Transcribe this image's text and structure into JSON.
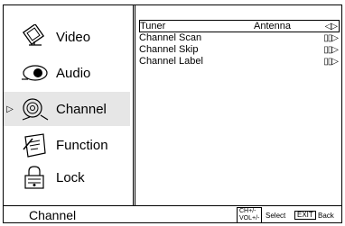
{
  "sidebar": {
    "items": [
      {
        "label": "Video",
        "icon": "monitor-icon"
      },
      {
        "label": "Audio",
        "icon": "speaker-icon"
      },
      {
        "label": "Channel",
        "icon": "satellite-dish-icon",
        "selected": true
      },
      {
        "label": "Function",
        "icon": "note-icon"
      },
      {
        "label": "Lock",
        "icon": "lock-icon"
      }
    ],
    "selected_marker": "▷"
  },
  "content": {
    "rows": [
      {
        "label": "Tuner",
        "value": "Antenna",
        "control": "◁▷"
      },
      {
        "label": "Channel Scan",
        "value": "",
        "control": "▯▯▷"
      },
      {
        "label": "Channel Skip",
        "value": "",
        "control": "▯▯▷"
      },
      {
        "label": "Channel Label",
        "value": "",
        "control": "▯▯▷"
      }
    ]
  },
  "footer": {
    "title": "Channel",
    "keys_line1": "CH+/-",
    "keys_line2": "VOL+/-",
    "select_label": "Select",
    "exit_key": "EXIT",
    "back_label": "Back"
  }
}
